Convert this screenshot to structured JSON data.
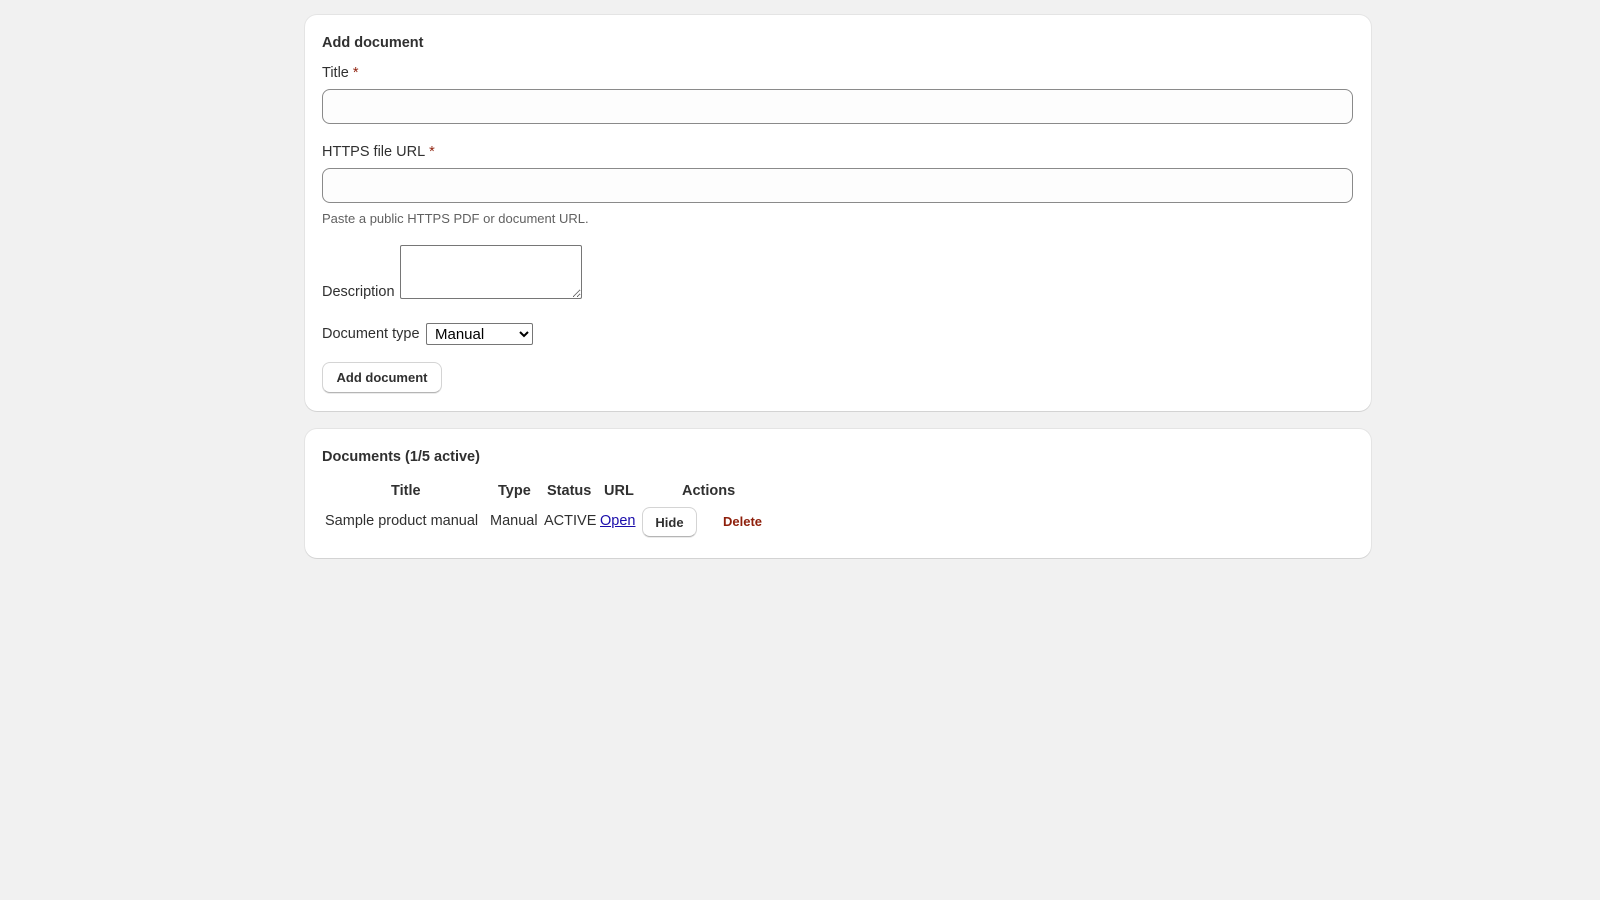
{
  "add_form": {
    "card_title": "Add document",
    "title_label": "Title",
    "required_mark": "*",
    "title_value": "",
    "url_label": "HTTPS file URL",
    "url_value": "",
    "url_help": "Paste a public HTTPS PDF or document URL.",
    "description_label": "Description",
    "description_value": "",
    "doc_type_label": "Document type",
    "doc_type_selected": "Manual",
    "submit_label": "Add document"
  },
  "documents": {
    "card_title": "Documents (1/5 active)",
    "columns": [
      "Title",
      "Type",
      "Status",
      "URL",
      "Actions"
    ],
    "rows": [
      {
        "title": "Sample product manual",
        "type": "Manual",
        "status": "ACTIVE",
        "url_link": "Open",
        "hide_label": "Hide",
        "delete_label": "Delete"
      }
    ]
  },
  "colors": {
    "background": "#f1f1f1",
    "card": "#ffffff",
    "required": "#8e1f0b",
    "delete": "#8e1f0b",
    "link": "#1a0dab"
  }
}
